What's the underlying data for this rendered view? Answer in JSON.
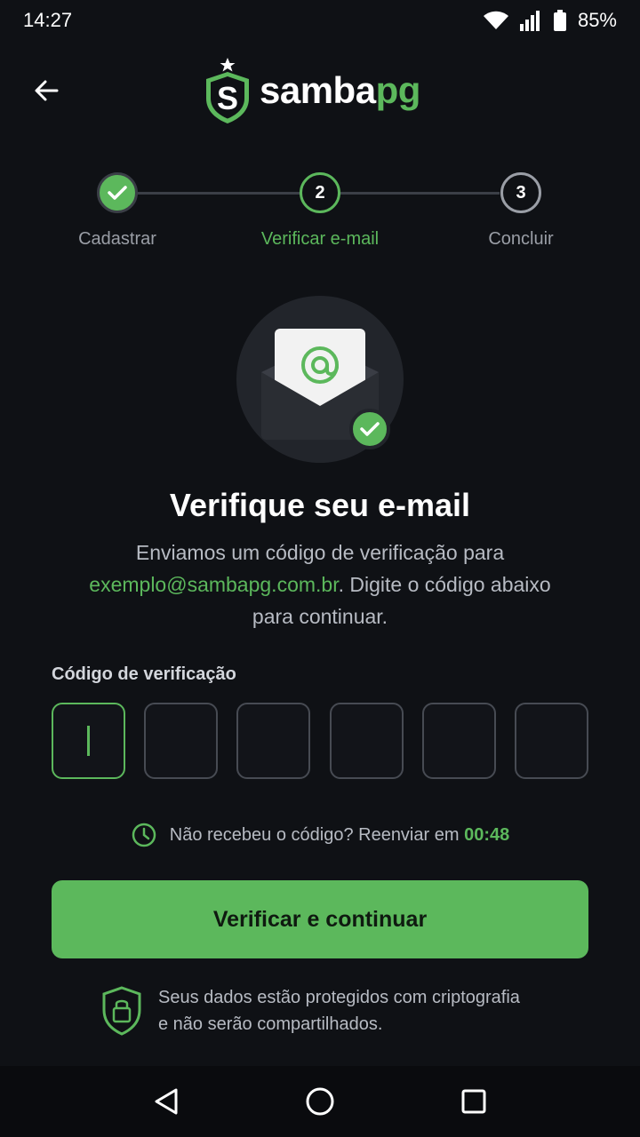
{
  "status_bar": {
    "time": "14:27",
    "battery": "85%"
  },
  "header": {
    "logo_main": "samba",
    "logo_accent": "pg"
  },
  "stepper": {
    "steps": [
      {
        "number": "1",
        "label": "Cadastrar",
        "state": "done"
      },
      {
        "number": "2",
        "label": "Verificar e-mail",
        "state": "current"
      },
      {
        "number": "3",
        "label": "Concluir",
        "state": "pending"
      }
    ]
  },
  "hero": {
    "icon": "envelope-at-icon",
    "badge": "check-icon"
  },
  "content": {
    "title": "Verifique seu e-mail",
    "desc_line1": "Enviamos um código de verificação para",
    "email": "exemplo@sambapg.com.br",
    "desc_line2_rest": ". Digite o código abaixo",
    "desc_line3": "para continuar."
  },
  "code": {
    "label": "Código de verificação",
    "digits": [
      "",
      "",
      "",
      "",
      "",
      ""
    ]
  },
  "resend": {
    "text": "Não recebeu o código? Reenviar em",
    "timer": "00:48"
  },
  "button": {
    "label": "Verificar e continuar"
  },
  "security": {
    "line1": "Seus dados estão protegidos com criptografia",
    "line2": "e não serão compartilhados."
  },
  "colors": {
    "accent": "#5cb85c",
    "background": "#0f1115",
    "surface": "#22252b"
  }
}
